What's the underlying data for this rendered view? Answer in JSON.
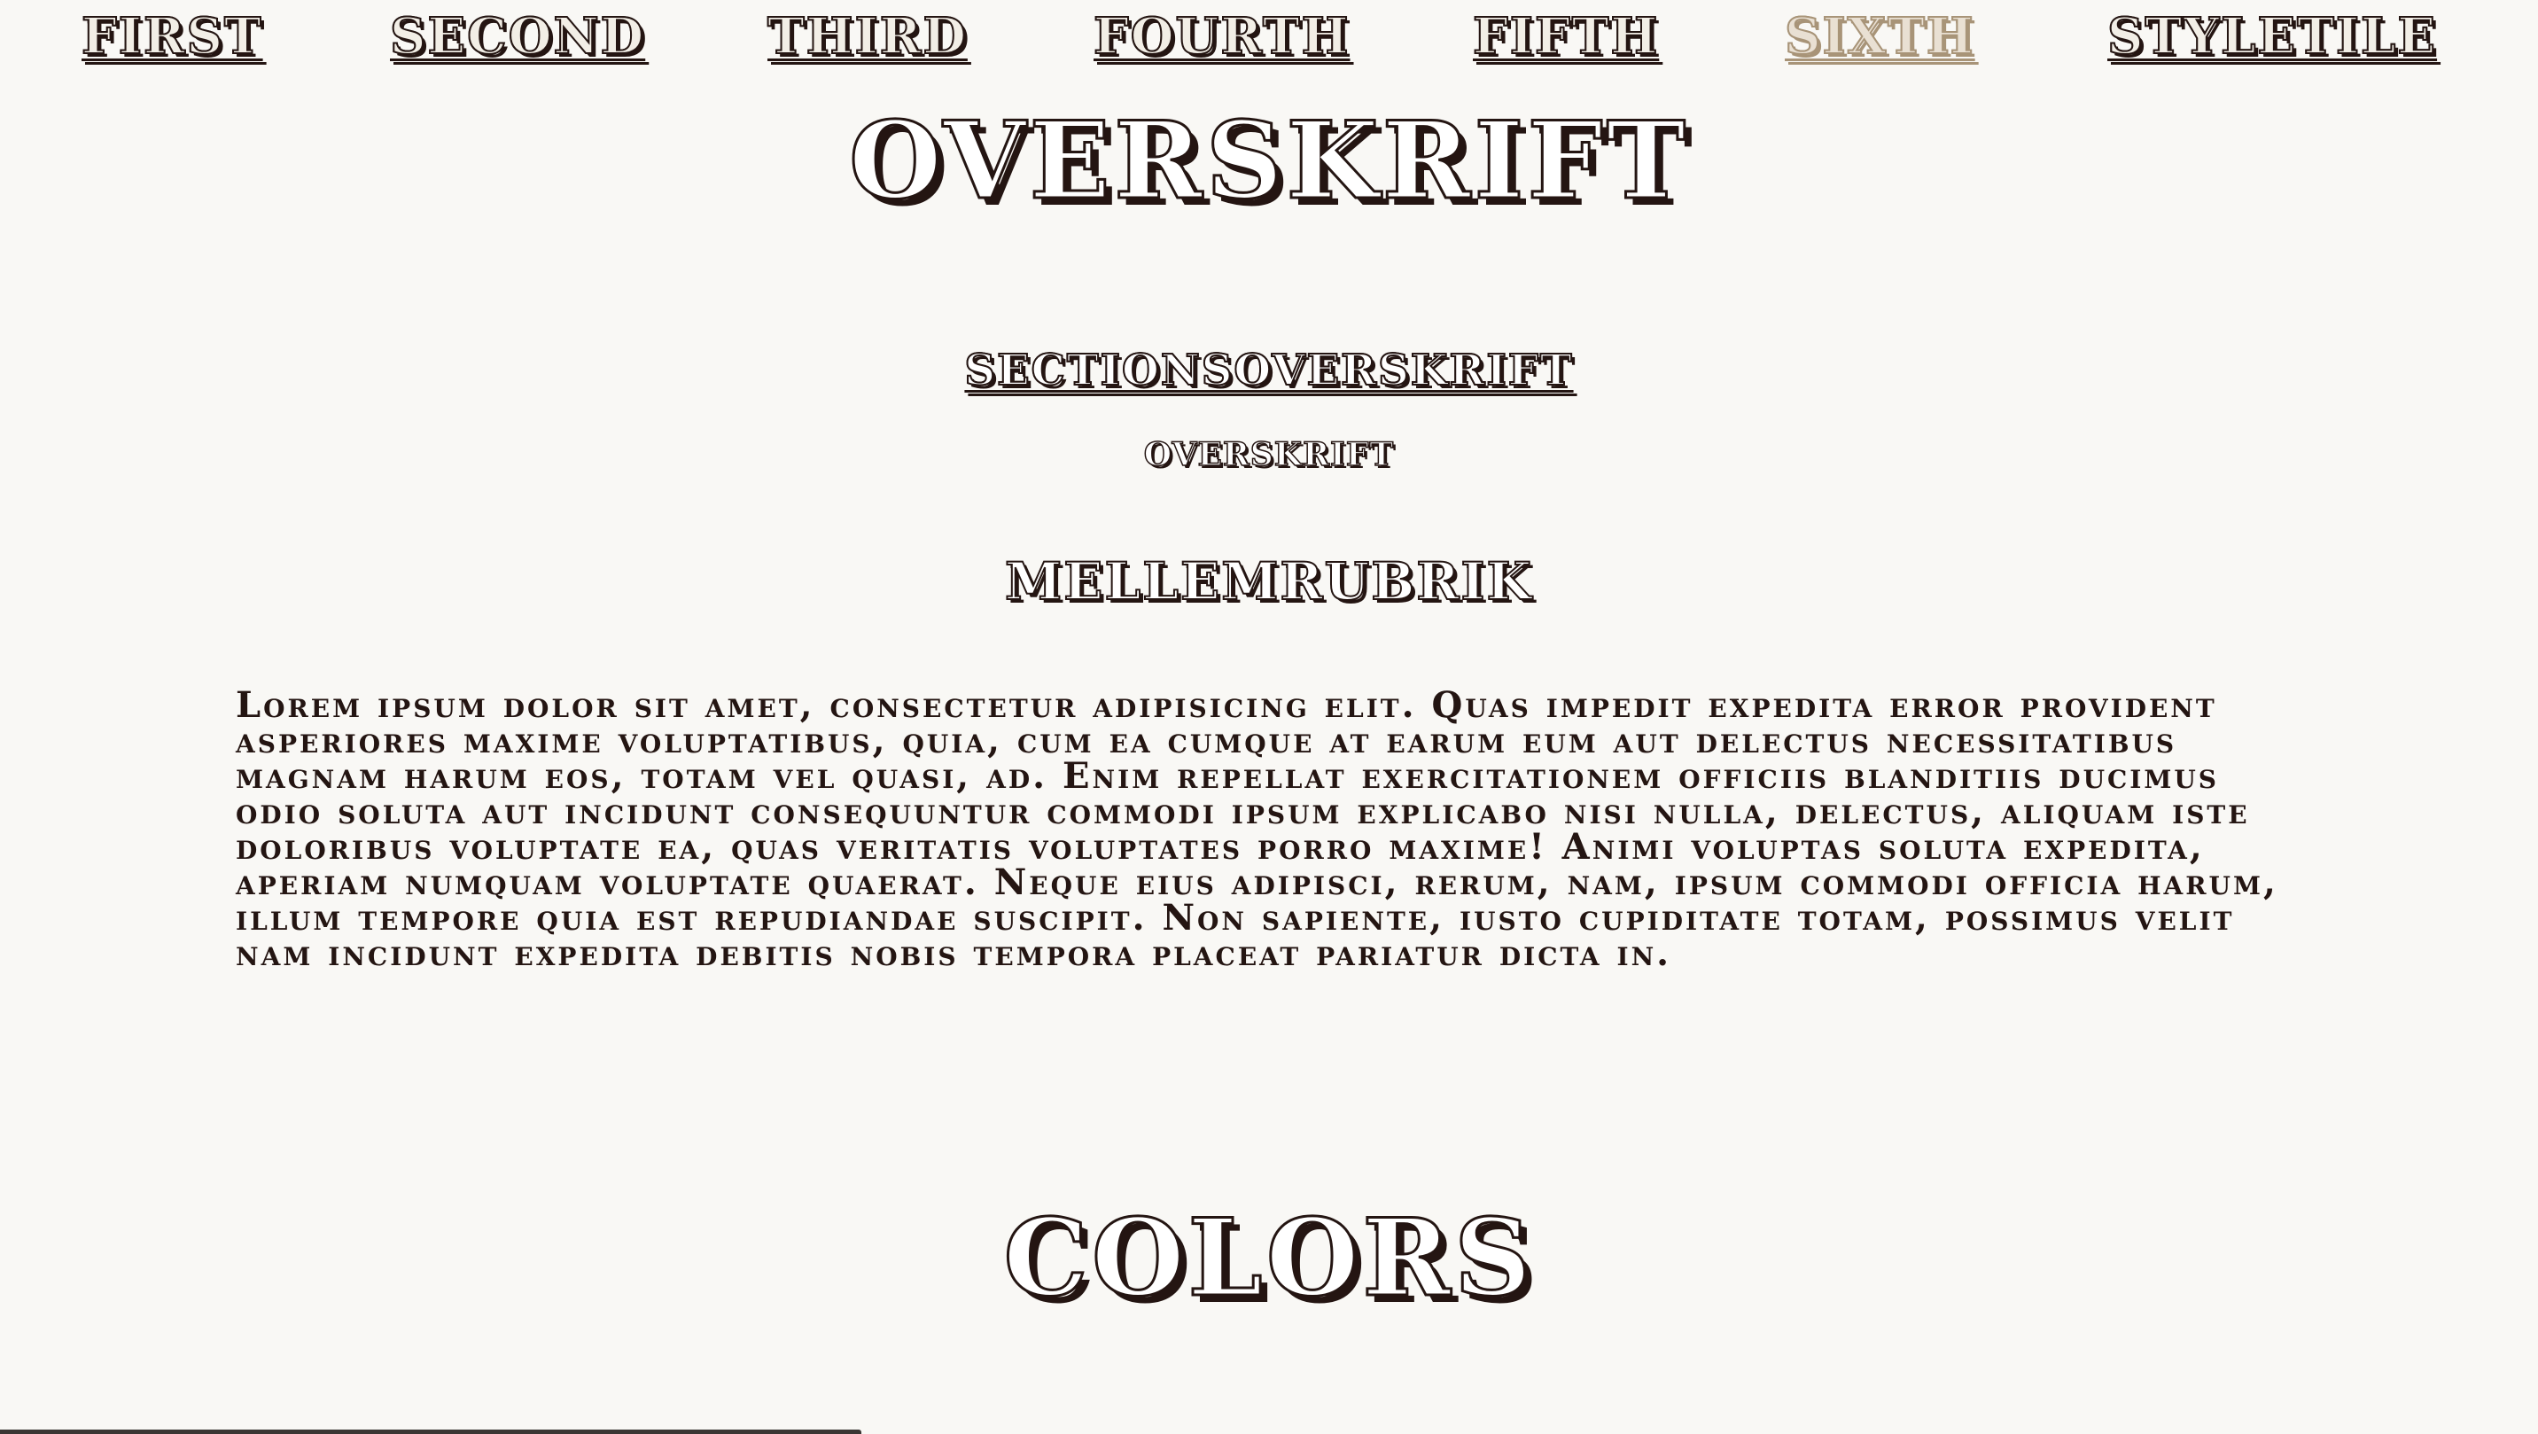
{
  "nav": {
    "items": [
      {
        "label": "First"
      },
      {
        "label": "Second"
      },
      {
        "label": "Third"
      },
      {
        "label": "Fourth"
      },
      {
        "label": "Fifth"
      },
      {
        "label": "Sixth",
        "active": true
      },
      {
        "label": "Styletile"
      }
    ]
  },
  "main": {
    "title": "Overskrift",
    "section_title": "Sectionsoverskrift",
    "subtitle": "Overskrift",
    "mellemrubrik": "Mellemrubrik",
    "body": "Lorem ipsum dolor sit amet, consectetur adipisicing elit. Quas impedit expedita error provident asperiores maxime voluptatibus, quia, cum ea cumque at earum eum aut delectus necessitatibus magnam harum eos, totam vel quasi, ad. Enim repellat exercitationem officiis blanditiis ducimus odio soluta aut incidunt consequuntur commodi ipsum explicabo nisi nulla, delectus, aliquam iste doloribus voluptate ea, quas veritatis voluptates porro maxime! Animi voluptas soluta expedita, aperiam numquam voluptate quaerat. Neque eius adipisci, rerum, nam, ipsum commodi officia harum, illum tempore quia est repudiandae suscipit. Non sapiente, iusto cupiditate totam, possimus velit nam incidunt expedita debitis nobis tempora placeat pariatur dicta in.",
    "colors_title": "Colors"
  },
  "colors": {
    "text": "#241512",
    "active_nav": "#a89478",
    "background": "#f9f8f5"
  }
}
